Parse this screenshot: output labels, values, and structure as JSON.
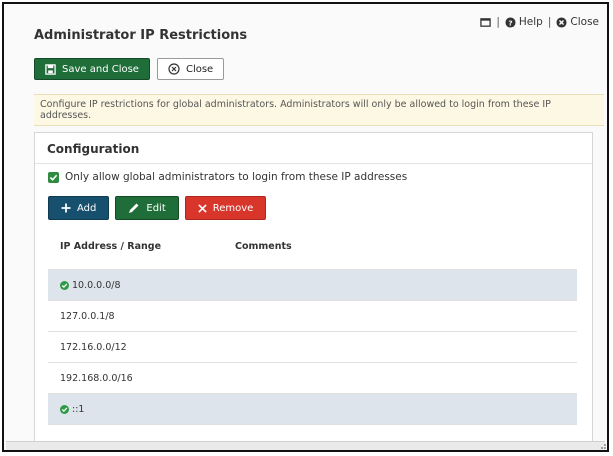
{
  "window": {
    "title": "Administrator IP Restrictions",
    "links": {
      "help": "Help",
      "close": "Close"
    }
  },
  "toolbar": {
    "save_label": "Save and Close",
    "close_label": "Close"
  },
  "notice": "Configure IP restrictions for global administrators. Administrators will only be allowed to login from these IP addresses.",
  "configuration": {
    "title": "Configuration",
    "checkbox_label": "Only allow global administrators to login from these IP addresses",
    "checked": true,
    "actions": {
      "add": "Add",
      "edit": "Edit",
      "remove": "Remove"
    },
    "table": {
      "columns": [
        "IP Address / Range",
        "Comments"
      ],
      "rows": [
        {
          "ip": "10.0.0.0/8",
          "comment": "",
          "selected": true,
          "status_icon": "check-circle"
        },
        {
          "ip": "127.0.0.1/8",
          "comment": "",
          "selected": false
        },
        {
          "ip": "172.16.0.0/12",
          "comment": "",
          "selected": false
        },
        {
          "ip": "192.168.0.0/16",
          "comment": "",
          "selected": false
        },
        {
          "ip": "::1",
          "comment": "",
          "selected": true,
          "status_icon": "check-circle"
        }
      ]
    }
  },
  "colors": {
    "primary_green": "#1f6e39",
    "add_blue": "#17506e",
    "remove_red": "#d9362b",
    "selected_row": "#dde4ec",
    "notice_bg": "#fdf8e4"
  }
}
